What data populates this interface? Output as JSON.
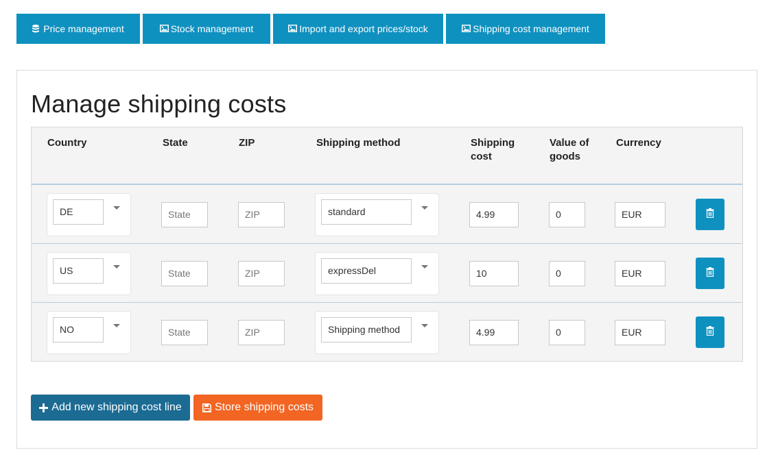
{
  "tabs": [
    {
      "label": "Price management",
      "icon": "database-icon"
    },
    {
      "label": "Stock management",
      "icon": "image-icon"
    },
    {
      "label": "Import and export prices/stock",
      "icon": "image-icon"
    },
    {
      "label": "Shipping cost management",
      "icon": "image-icon"
    }
  ],
  "page": {
    "title": "Manage shipping costs"
  },
  "table": {
    "headers": {
      "country": "Country",
      "state": "State",
      "zip": "ZIP",
      "method": "Shipping method",
      "cost": "Shipping cost",
      "value": "Value of goods",
      "currency": "Currency"
    },
    "placeholders": {
      "state": "State",
      "zip": "ZIP",
      "method": "Shipping method"
    },
    "rows": [
      {
        "country": "DE",
        "state": "",
        "zip": "",
        "method": "standard",
        "cost": "4.99",
        "value": "0",
        "currency": "EUR"
      },
      {
        "country": "US",
        "state": "",
        "zip": "",
        "method": "expressDel",
        "cost": "10",
        "value": "0",
        "currency": "EUR"
      },
      {
        "country": "NO",
        "state": "",
        "zip": "",
        "method": "",
        "cost": "4.99",
        "value": "0",
        "currency": "EUR"
      }
    ]
  },
  "actions": {
    "add_label": "Add new shipping cost line",
    "store_label": "Store shipping costs"
  },
  "colors": {
    "primary": "#0f91c0",
    "add": "#1b6b93",
    "store": "#f26522"
  }
}
